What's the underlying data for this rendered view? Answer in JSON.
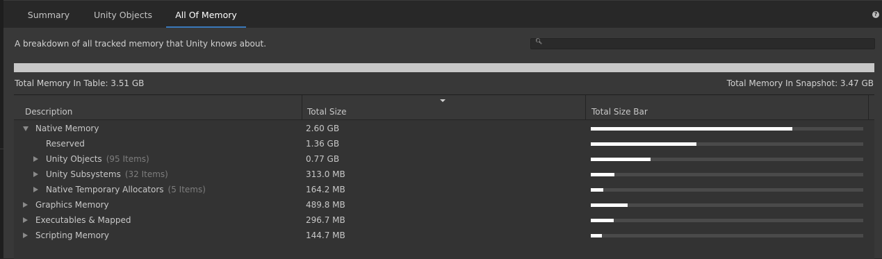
{
  "tabs": [
    {
      "label": "Summary"
    },
    {
      "label": "Unity Objects"
    },
    {
      "label": "All Of Memory"
    }
  ],
  "help_icon": "help-icon",
  "description": "A breakdown of all tracked memory that Unity knows about.",
  "search": {
    "placeholder": "",
    "value": "",
    "icon": "search-icon"
  },
  "totals": {
    "table": "Total Memory In Table: 3.51 GB",
    "snapshot": "Total Memory In Snapshot: 3.47 GB"
  },
  "columns": {
    "description": "Description",
    "total_size": "Total Size",
    "total_size_bar": "Total Size Bar",
    "sorted_by": "Total Size",
    "sort_direction": "descending"
  },
  "rows": [
    {
      "name": "Native Memory",
      "count": "",
      "size": "2.60 GB",
      "fraction": 0.741,
      "depth": 0,
      "state": "expanded"
    },
    {
      "name": "Reserved",
      "count": "",
      "size": "1.36 GB",
      "fraction": 0.388,
      "depth": 1,
      "state": "leaf"
    },
    {
      "name": "Unity Objects",
      "count": "(95 Items)",
      "size": "0.77 GB",
      "fraction": 0.219,
      "depth": 1,
      "state": "collapsed"
    },
    {
      "name": "Unity Subsystems",
      "count": "(32 Items)",
      "size": "313.0 MB",
      "fraction": 0.087,
      "depth": 1,
      "state": "collapsed"
    },
    {
      "name": "Native Temporary Allocators",
      "count": "(5 Items)",
      "size": "164.2 MB",
      "fraction": 0.046,
      "depth": 1,
      "state": "collapsed"
    },
    {
      "name": "Graphics Memory",
      "count": "",
      "size": "489.8 MB",
      "fraction": 0.136,
      "depth": 0,
      "state": "collapsed"
    },
    {
      "name": "Executables & Mapped",
      "count": "",
      "size": "296.7 MB",
      "fraction": 0.083,
      "depth": 0,
      "state": "collapsed"
    },
    {
      "name": "Scripting Memory",
      "count": "",
      "size": "144.7 MB",
      "fraction": 0.04,
      "depth": 0,
      "state": "collapsed"
    }
  ],
  "colors": {
    "accent": "#3a79bb",
    "bar_fill": "#ffffff",
    "bar_track": "#4a4a4a",
    "capacity_bar": "#c8c8c8"
  }
}
